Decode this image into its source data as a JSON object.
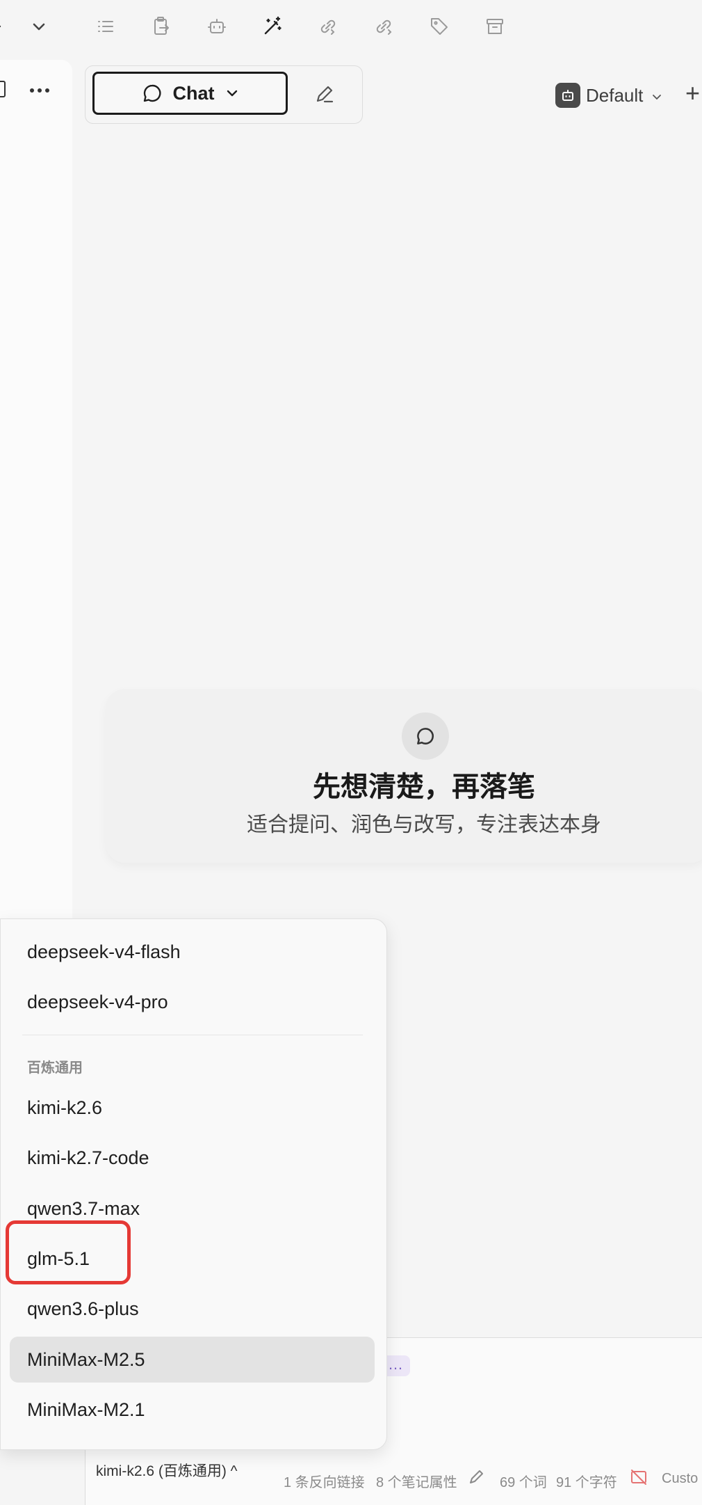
{
  "toolbar": {
    "icons": [
      "back-icon",
      "chevron-down-icon",
      "list-icon",
      "clipboard-export-icon",
      "bot-icon",
      "magic-wand-icon",
      "link-in-icon",
      "link-out-icon",
      "tag-icon",
      "archive-icon"
    ]
  },
  "header": {
    "mode_label": "Chat",
    "agent_label": "Default",
    "add_label": "+"
  },
  "empty_state": {
    "title": "先想清楚，再落笔",
    "subtitle": "适合提问、润色与改写，专注表达本身"
  },
  "model_menu": {
    "items_top": [
      "deepseek-v4-flash",
      "deepseek-v4-pro"
    ],
    "group_label": "百炼通用",
    "items_group": [
      "kimi-k2.6",
      "kimi-k2.7-code",
      "qwen3.7-max",
      "glm-5.1",
      "qwen3.6-plus",
      "MiniMax-M2.5",
      "MiniMax-M2.1"
    ],
    "selected": "MiniMax-M2.5",
    "highlighted": "glm-5.1"
  },
  "composer": {
    "chip_text": "…",
    "model_selector": "kimi-k2.6 (百炼通用) ^"
  },
  "status_bar": {
    "backlinks": "1 条反向链接",
    "properties": "8 个笔记属性",
    "words": "69 个词",
    "chars": "91 个字符",
    "custom": "Custo"
  },
  "colors": {
    "accent_highlight": "#e53935",
    "chip_bg": "#ece6f7",
    "chip_text": "#7b61c6"
  }
}
